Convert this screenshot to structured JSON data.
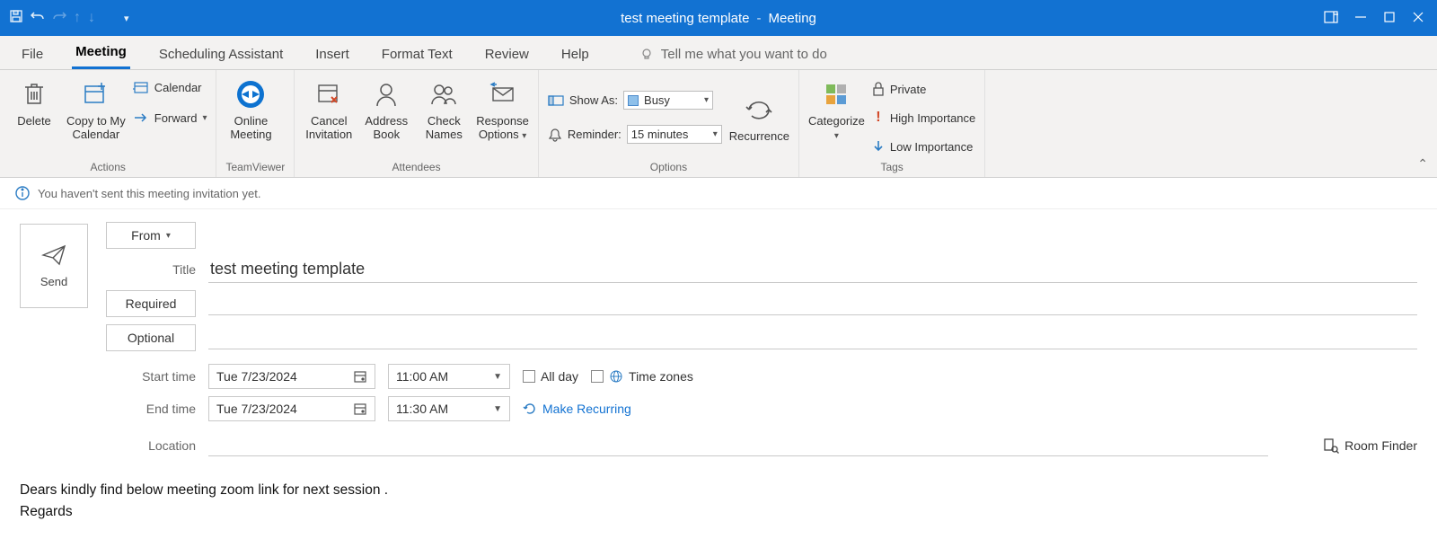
{
  "titlebar": {
    "doc_title": "test meeting template",
    "separator": "-",
    "window_type": "Meeting"
  },
  "tabs": {
    "file": "File",
    "meeting": "Meeting",
    "scheduling": "Scheduling Assistant",
    "insert": "Insert",
    "format": "Format Text",
    "review": "Review",
    "help": "Help",
    "tellme": "Tell me what you want to do"
  },
  "ribbon": {
    "actions": {
      "group": "Actions",
      "delete": "Delete",
      "copy": "Copy to My\nCalendar",
      "calendar": "Calendar",
      "forward": "Forward"
    },
    "teamviewer": {
      "group": "TeamViewer",
      "online": "Online\nMeeting"
    },
    "attendees": {
      "group": "Attendees",
      "cancel": "Cancel\nInvitation",
      "address": "Address\nBook",
      "check": "Check\nNames",
      "response": "Response\nOptions"
    },
    "options": {
      "group": "Options",
      "showas_label": "Show As:",
      "showas_value": "Busy",
      "reminder_label": "Reminder:",
      "reminder_value": "15 minutes",
      "recurrence": "Recurrence"
    },
    "tags": {
      "group": "Tags",
      "categorize": "Categorize",
      "private": "Private",
      "high": "High Importance",
      "low": "Low Importance"
    }
  },
  "info_bar": "You haven't sent this meeting invitation yet.",
  "form": {
    "send": "Send",
    "from": "From",
    "title_label": "Title",
    "title_value": "test meeting template",
    "required": "Required",
    "optional": "Optional",
    "start_label": "Start time",
    "end_label": "End time",
    "start_date": "Tue 7/23/2024",
    "start_time": "11:00 AM",
    "end_date": "Tue 7/23/2024",
    "end_time": "11:30 AM",
    "all_day": "All day",
    "time_zones": "Time zones",
    "make_recurring": "Make Recurring",
    "location_label": "Location",
    "location_value": "",
    "room_finder": "Room Finder",
    "required_value": "",
    "optional_value": ""
  },
  "body": {
    "line1": "Dears kindly find below meeting zoom link for next session .",
    "line2": "Regards"
  }
}
